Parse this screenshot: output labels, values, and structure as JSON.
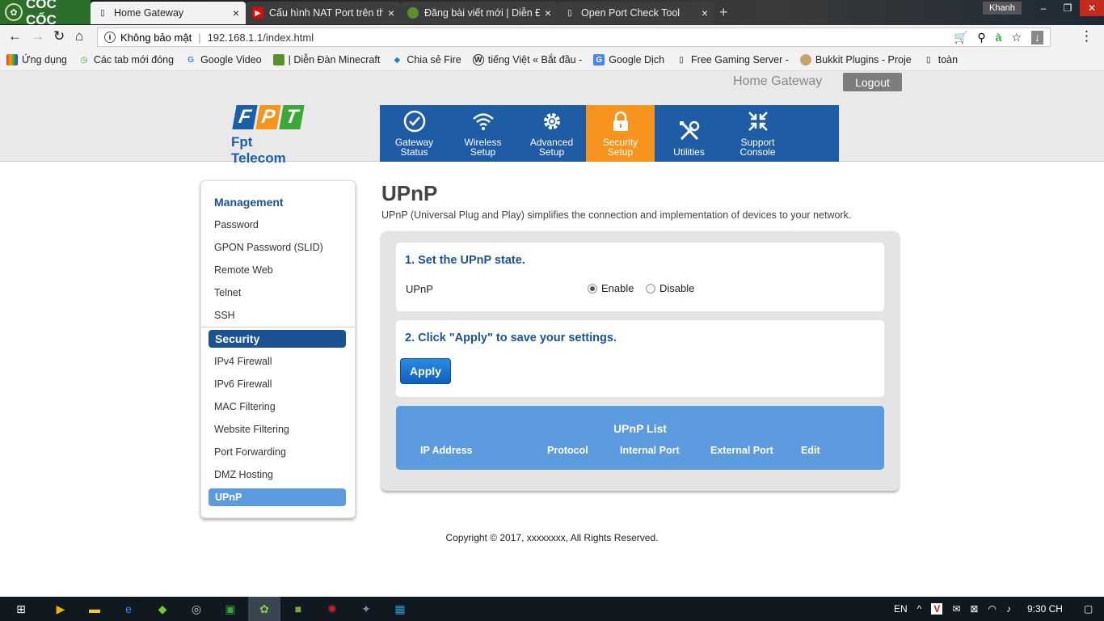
{
  "browser": {
    "brand": "CỐC CỐC",
    "tabs": [
      {
        "label": "Home Gateway",
        "icon": "page-icon",
        "active": true
      },
      {
        "label": "Cấu hình NAT Port trên th",
        "icon": "youtube-icon",
        "active": false
      },
      {
        "label": "Đăng bài viết mới | Diễn Đ",
        "icon": "minecraft-icon",
        "active": false
      },
      {
        "label": "Open Port Check Tool",
        "icon": "page-icon",
        "active": false
      }
    ],
    "user": "Khanh",
    "omnibox": {
      "security": "Không bảo mật",
      "url": "192.168.1.1/index.html"
    },
    "bookmarks": [
      {
        "label": "Ứng dụng",
        "icon": "apps-grid-icon"
      },
      {
        "label": "Các tab mới đóng",
        "icon": "history-icon"
      },
      {
        "label": "Google Video",
        "icon": "google-icon"
      },
      {
        "label": "| Diễn Đàn Minecraft",
        "icon": "minecraft-icon"
      },
      {
        "label": "Chia sẻ Fire",
        "icon": "fire-icon"
      },
      {
        "label": "tiếng Việt « Bắt đầu -",
        "icon": "wordpress-icon"
      },
      {
        "label": "Google Dịch",
        "icon": "translate-icon"
      },
      {
        "label": "Free Gaming Server -",
        "icon": "page-icon"
      },
      {
        "label": "Bukkit Plugins - Proje",
        "icon": "bukkit-icon"
      },
      {
        "label": "toàn",
        "icon": "page-icon"
      }
    ]
  },
  "header": {
    "title": "Home Gateway",
    "logout": "Logout"
  },
  "logo": {
    "letters": [
      "F",
      "P",
      "T"
    ],
    "subtitle": "Fpt Telecom",
    "colors": [
      "#1a5fa8",
      "#f7941d",
      "#3aa935"
    ]
  },
  "nav": [
    {
      "line1": "Gateway",
      "line2": "Status",
      "icon": "check-circle-icon",
      "active": false
    },
    {
      "line1": "Wireless",
      "line2": "Setup",
      "icon": "wifi-icon",
      "active": false
    },
    {
      "line1": "Advanced",
      "line2": "Setup",
      "icon": "gear-icon",
      "active": false
    },
    {
      "line1": "Security",
      "line2": "Setup",
      "icon": "lock-icon",
      "active": true
    },
    {
      "line1": "Utilities",
      "line2": "",
      "icon": "tools-icon",
      "active": false
    },
    {
      "line1": "Support",
      "line2": "Console",
      "icon": "arrows-in-icon",
      "active": false
    }
  ],
  "sidebar": {
    "management_heading": "Management",
    "management_items": [
      "Password",
      "GPON Password (SLID)",
      "Remote Web",
      "Telnet",
      "SSH"
    ],
    "security_heading": "Security",
    "security_items": [
      "IPv4 Firewall",
      "IPv6 Firewall",
      "MAC Filtering",
      "Website Filtering",
      "Port Forwarding",
      "DMZ Hosting",
      "UPnP"
    ],
    "active_item": "UPnP"
  },
  "content": {
    "title": "UPnP",
    "description": "UPnP (Universal Plug and Play) simplifies the connection and implementation of devices to your network.",
    "step1": "1. Set the UPnP state.",
    "upnp_label": "UPnP",
    "enable": "Enable",
    "disable": "Disable",
    "selected": "Enable",
    "step2": "2. Click \"Apply\" to save your settings.",
    "apply": "Apply",
    "list_title": "UPnP List",
    "columns": [
      "IP Address",
      "Protocol",
      "Internal Port",
      "External Port",
      "Edit"
    ]
  },
  "footer": {
    "copyright": "Copyright © 2017, xxxxxxxx, All Rights Reserved."
  },
  "taskbar": {
    "language": "EN",
    "time": "9:30 CH"
  },
  "colors": {
    "fpt_blue": "#1f5ca6",
    "accent_orange": "#f7941d",
    "heading_blue": "#1a5293",
    "list_blue": "#5b9bde"
  }
}
